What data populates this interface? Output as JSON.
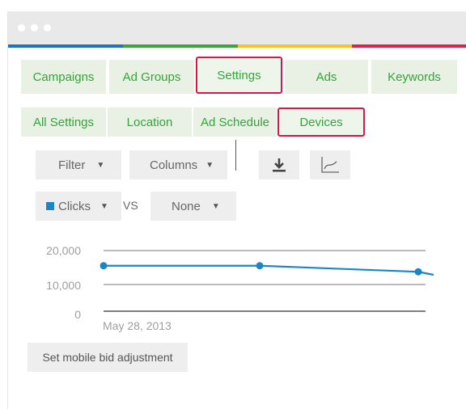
{
  "colors": {
    "bar_blue": "#1a73c3",
    "bar_green": "#3aa63c",
    "bar_yellow": "#f7c325",
    "bar_red": "#e0204d",
    "tab_text": "#36a33b",
    "active_border": "#d6174a",
    "series": "#1a86c8"
  },
  "tabs": [
    {
      "label": "Campaigns",
      "active": false
    },
    {
      "label": "Ad Groups",
      "active": false
    },
    {
      "label": "Settings",
      "active": true
    },
    {
      "label": "Ads",
      "active": false
    },
    {
      "label": "Keywords",
      "active": false
    }
  ],
  "subtabs": [
    {
      "label": "All Settings",
      "active": false
    },
    {
      "label": "Location",
      "active": false
    },
    {
      "label": "Ad Schedule",
      "active": false
    },
    {
      "label": "Devices",
      "active": true
    }
  ],
  "toolbar": {
    "filter_label": "Filter",
    "columns_label": "Columns",
    "download_icon": "download-icon",
    "chart_icon": "chart-icon"
  },
  "compare": {
    "metric_label": "Clicks",
    "vs_label": "VS",
    "second_label": "None"
  },
  "chart_data": {
    "type": "line",
    "y_ticks": [
      "20,000",
      "10,000",
      "0"
    ],
    "ylim": [
      0,
      20000
    ],
    "x_label": "May 28, 2013",
    "series": [
      {
        "values": [
          15000,
          15000,
          13000,
          12000
        ]
      }
    ]
  },
  "action": {
    "bid_label": "Set mobile bid adjustment"
  }
}
